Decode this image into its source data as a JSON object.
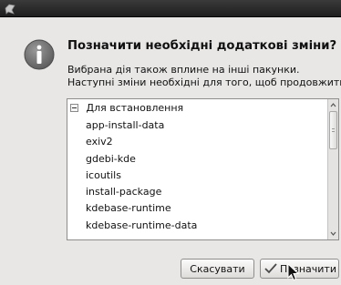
{
  "dialog": {
    "heading": "Позначити необхідні додаткові зміни?",
    "description_line1": "Вибрана дія також вплине на інші пакунки.",
    "description_line2": "Наступні зміни необхідні для того, щоб продовжити."
  },
  "list": {
    "group_label": "Для встановлення",
    "group_expanded": true,
    "packages": [
      "app-install-data",
      "exiv2",
      "gdebi-kde",
      "icoutils",
      "install-package",
      "kdebase-runtime",
      "kdebase-runtime-data"
    ]
  },
  "buttons": {
    "cancel_label": "Скасувати",
    "apply_label": "Позначити"
  },
  "icons": {
    "app": "system-icon",
    "info": "info-icon",
    "expander": "collapse-icon",
    "apply": "checkmark-icon"
  },
  "colors": {
    "info_circle": "#6f6f6f",
    "titlebar": "#2a2a2a",
    "dialog_bg": "#e8e7e6"
  }
}
